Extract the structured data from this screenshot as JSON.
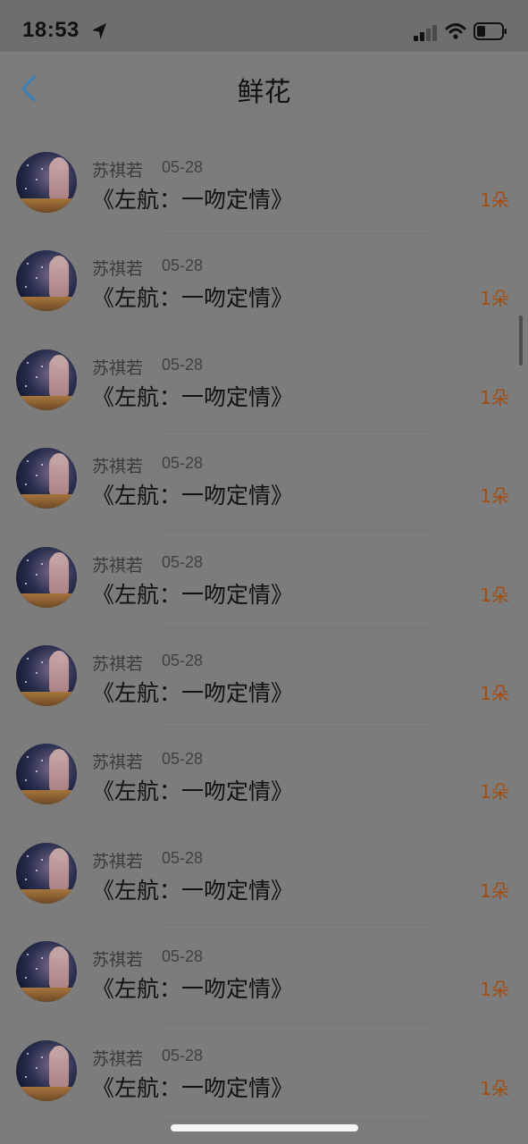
{
  "status_bar": {
    "time": "18:53",
    "icons": [
      "location-arrow-icon",
      "cellular-signal-icon",
      "wifi-icon",
      "battery-icon"
    ]
  },
  "nav": {
    "title": "鲜花",
    "back_icon": "chevron-left-icon",
    "accent_color": "#3f7fb2"
  },
  "items": [
    {
      "author": "苏祺若",
      "date": "05-28",
      "title": "《左航：一吻定情》",
      "count": "1朵"
    },
    {
      "author": "苏祺若",
      "date": "05-28",
      "title": "《左航：一吻定情》",
      "count": "1朵"
    },
    {
      "author": "苏祺若",
      "date": "05-28",
      "title": "《左航：一吻定情》",
      "count": "1朵"
    },
    {
      "author": "苏祺若",
      "date": "05-28",
      "title": "《左航：一吻定情》",
      "count": "1朵"
    },
    {
      "author": "苏祺若",
      "date": "05-28",
      "title": "《左航：一吻定情》",
      "count": "1朵"
    },
    {
      "author": "苏祺若",
      "date": "05-28",
      "title": "《左航：一吻定情》",
      "count": "1朵"
    },
    {
      "author": "苏祺若",
      "date": "05-28",
      "title": "《左航：一吻定情》",
      "count": "1朵"
    },
    {
      "author": "苏祺若",
      "date": "05-28",
      "title": "《左航：一吻定情》",
      "count": "1朵"
    },
    {
      "author": "苏祺若",
      "date": "05-28",
      "title": "《左航：一吻定情》",
      "count": "1朵"
    },
    {
      "author": "苏祺若",
      "date": "05-28",
      "title": "《左航：一吻定情》",
      "count": "1朵"
    }
  ],
  "colors": {
    "count": "#a44d12",
    "overlay": "#7c7c7c"
  }
}
